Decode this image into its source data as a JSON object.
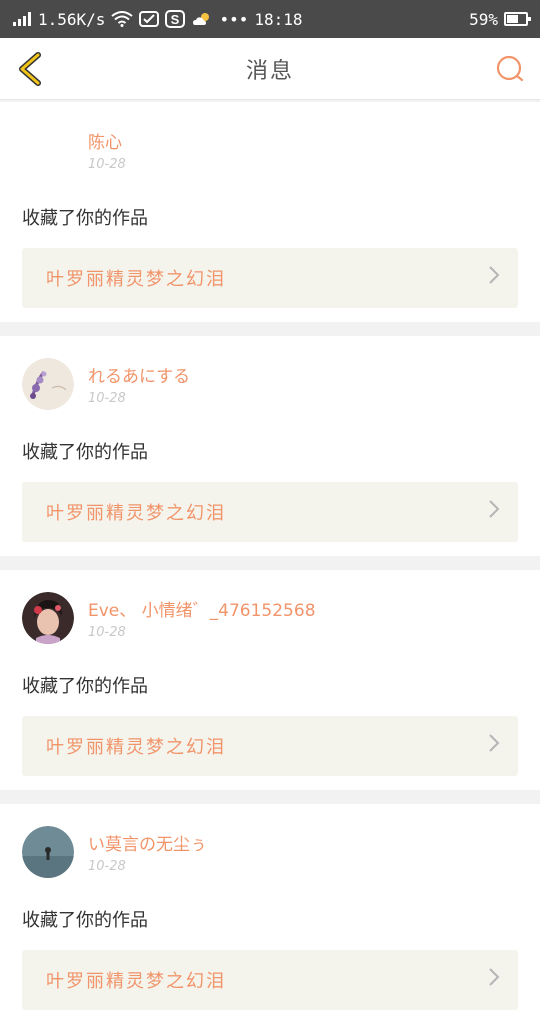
{
  "status_bar": {
    "speed": "1.56K/s",
    "time": "18:18",
    "battery": "59%",
    "battery_level": 0.59
  },
  "header": {
    "title": "消息",
    "back_icon": "chevron-left-icon",
    "search_icon": "search-icon"
  },
  "colors": {
    "accent": "#f2946a",
    "back_icon": "#f0c419",
    "link_bg": "#f4f4ed"
  },
  "notifications": [
    {
      "username": "陈心",
      "date": "10-28",
      "action": "收藏了你的作品",
      "work_title": "叶罗丽精灵梦之幻泪"
    },
    {
      "username": "れるあにする",
      "date": "10-28",
      "action": "收藏了你的作品",
      "work_title": "叶罗丽精灵梦之幻泪"
    },
    {
      "username": "Eve、 小情绪゛_476152568",
      "date": "10-28",
      "action": "收藏了你的作品",
      "work_title": "叶罗丽精灵梦之幻泪"
    },
    {
      "username": "い莫言の无尘ぅ",
      "date": "10-28",
      "action": "收藏了你的作品",
      "work_title": "叶罗丽精灵梦之幻泪"
    }
  ]
}
